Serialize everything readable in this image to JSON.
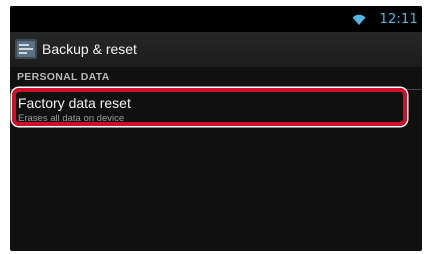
{
  "status_bar": {
    "time": "12:11",
    "wifi_icon": "wifi-icon",
    "accent_color": "#4fb6e8"
  },
  "action_bar": {
    "title": "Backup & reset",
    "icon": "settings-icon"
  },
  "section": {
    "header": "PERSONAL DATA"
  },
  "items": [
    {
      "title": "Factory data reset",
      "subtitle": "Erases all data on device"
    }
  ],
  "highlight_color": "#d0102b"
}
